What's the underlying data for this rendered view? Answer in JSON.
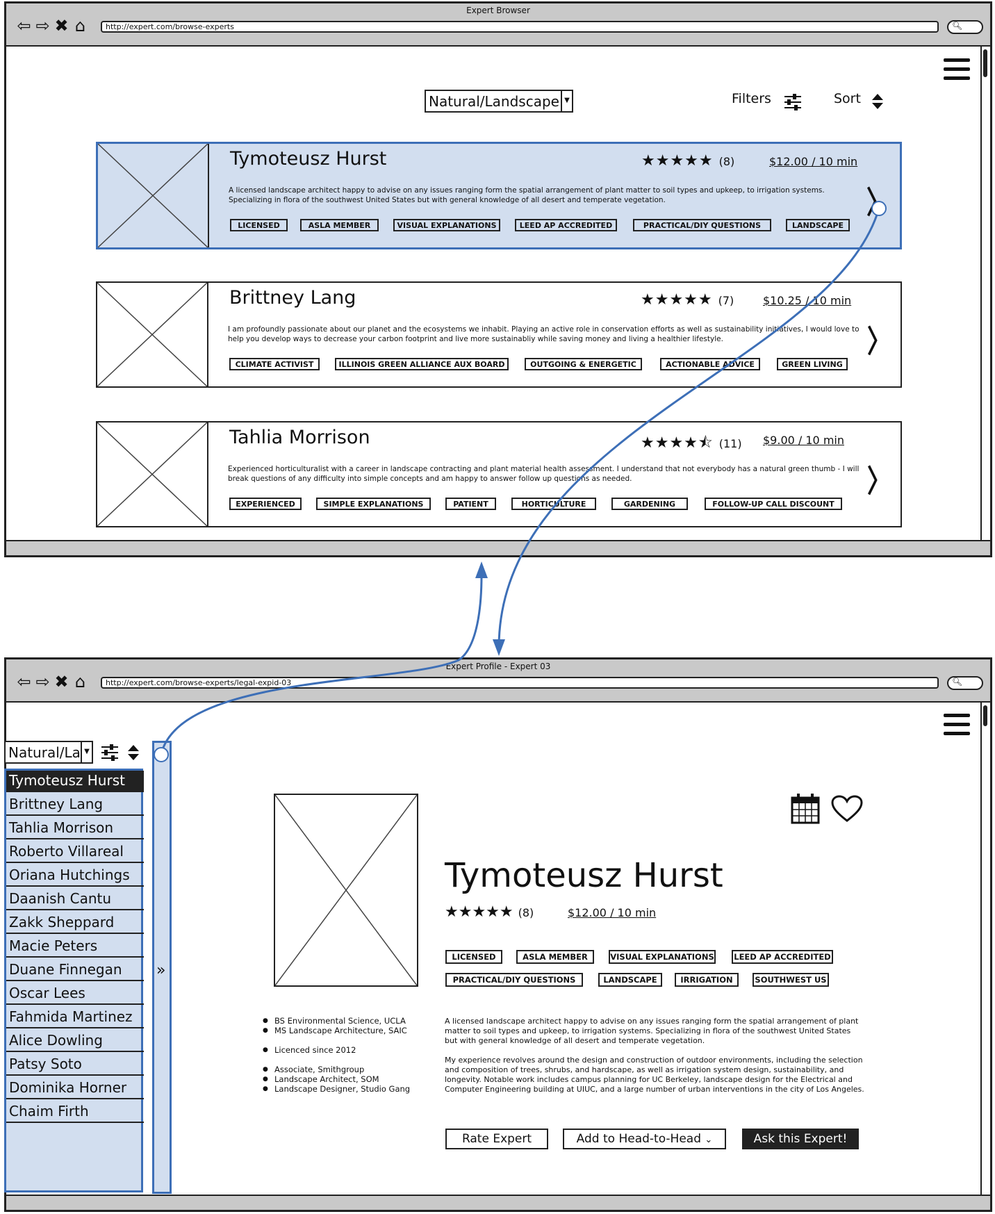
{
  "window1": {
    "title": "Expert Browser",
    "url": "http://expert.com/browse-experts",
    "category_select": "Natural/Landscape",
    "filters_label": "Filters",
    "sort_label": "Sort",
    "experts": [
      {
        "name": "Tymoteusz Hurst",
        "stars": "★★★★★",
        "count": "(8)",
        "price": "$12.00 / 10 min",
        "description": "A licensed landscape architect happy to advise on any issues ranging form the spatial arrangement of plant matter to soil types and upkeep, to irrigation systems. Specializing in flora of the southwest United States but with general knowledge of all desert and temperate vegetation.",
        "tags": [
          "LICENSED",
          "ASLA MEMBER",
          "VISUAL EXPLANATIONS",
          "LEED AP ACCREDITED",
          "PRACTICAL/DIY QUESTIONS",
          "LANDSCAPE"
        ]
      },
      {
        "name": "Brittney Lang",
        "stars": "★★★★★",
        "count": "(7)",
        "price": "$10.25 / 10 min",
        "description": "I am profoundly passionate about our planet and the ecosystems we inhabit. Playing an active role in conservation efforts as well as sustainability initiatives, I would love to help you develop ways to decrease your carbon footprint and live more sustainabliy while saving money and living a healthier lifestyle.",
        "tags": [
          "CLIMATE ACTIVIST",
          "ILLINOIS GREEN ALLIANCE AUX BOARD",
          "OUTGOING & ENERGETIC",
          "ACTIONABLE ADVICE",
          "GREEN LIVING"
        ]
      },
      {
        "name": "Tahlia Morrison",
        "stars": "★★★★⯪",
        "count": "(11)",
        "price": "$9.00 / 10 min",
        "description": "Experienced horticulturalist with a career in landscape contracting and plant material health assessment. I understand that not everybody has a natural green thumb - I will break questions of any difficulty into simple concepts and am happy to answer follow up questions as needed.",
        "tags": [
          "EXPERIENCED",
          "SIMPLE EXPLANATIONS",
          "PATIENT",
          "HORTICULTURE",
          "GARDENING",
          "FOLLOW-UP CALL DISCOUNT"
        ]
      }
    ]
  },
  "window2": {
    "title": "Expert Profile - Expert 03",
    "url": "http://expert.com/browse-experts/legal-expid-03",
    "category_select": "Natural/Lar",
    "collapse_glyph": "»",
    "sidebar_items": [
      "Tymoteusz Hurst",
      "Brittney Lang",
      "Tahlia Morrison",
      "Roberto Villareal",
      "Oriana Hutchings",
      "Daanish Cantu",
      "Zakk Sheppard",
      "Macie Peters",
      "Duane Finnegan",
      "Oscar Lees",
      "Fahmida Martinez",
      "Alice Dowling",
      "Patsy Soto",
      "Dominika Horner",
      "Chaim Firth"
    ],
    "profile": {
      "name": "Tymoteusz Hurst",
      "stars": "★★★★★",
      "count": "(8)",
      "price": "$12.00 / 10 min",
      "tags_row1": [
        "LICENSED",
        "ASLA MEMBER",
        "VISUAL EXPLANATIONS",
        "LEED AP ACCREDITED"
      ],
      "tags_row2": [
        "PRACTICAL/DIY QUESTIONS",
        "LANDSCAPE",
        "IRRIGATION",
        "SOUTHWEST US"
      ],
      "credentials": [
        "BS Environmental Science, UCLA",
        "MS Landscape Architecture, SAIC",
        "Licenced since 2012",
        "Associate, Smithgroup",
        "Landscape Architect, SOM",
        "Landscape Designer, Studio Gang"
      ],
      "bio1": "A licensed landscape architect happy to advise on any issues ranging form the spatial arrangement of plant matter to soil types and upkeep, to irrigation systems. Specializing in flora of the southwest United States but with general knowledge of all desert and temperate vegetation.",
      "bio2": "My experience revolves around the design and construction of outdoor environments, including the selection and composition of trees, shrubs, and hardscape, as well as irrigation system design, sustainability, and longevity. Notable work includes campus planning for UC Berkeley, landscape design for the Electrical and Computer Engineering building at UIUC, and a large number of urban interventions in the city of Los Angeles.",
      "rate_button": "Rate Expert",
      "head_button": "Add to Head-to-Head",
      "ask_button": "Ask this Expert!"
    }
  },
  "icons": [
    "back-arrow-icon",
    "forward-arrow-icon",
    "close-icon",
    "home-icon",
    "search-icon",
    "hamburger-menu-icon",
    "filter-sliders-icon",
    "sort-arrows-icon",
    "chevron-right-icon",
    "calendar-icon",
    "heart-icon",
    "chevron-down-icon"
  ],
  "colors": {
    "selection_fill": "#d2deef",
    "selection_border": "#3d6fb7",
    "flow_arrow": "#3d6fb7"
  }
}
